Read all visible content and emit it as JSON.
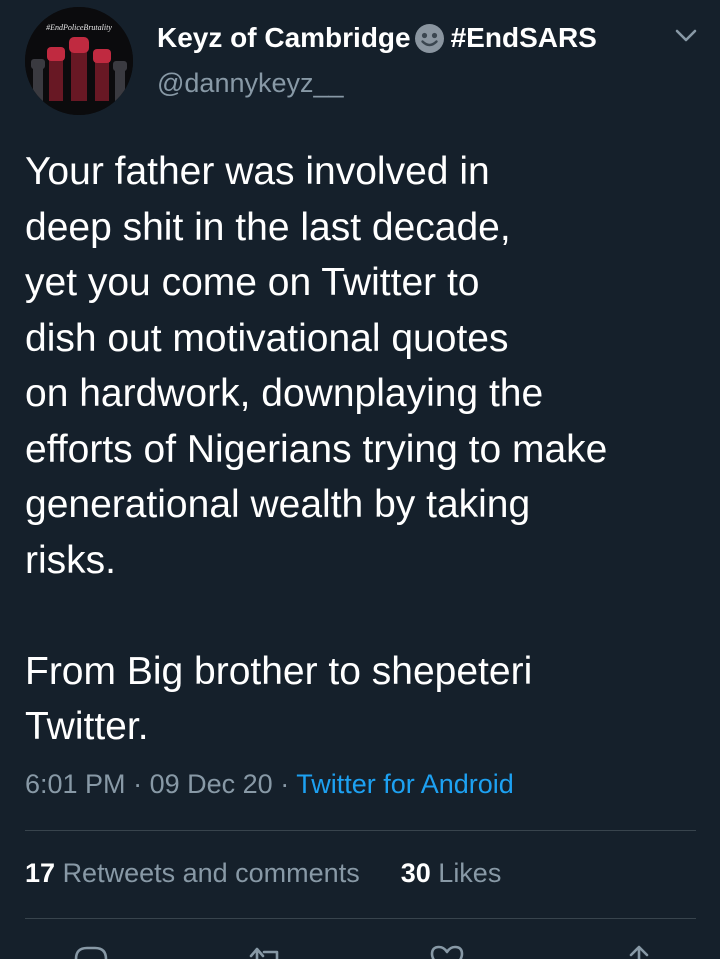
{
  "tweet": {
    "avatar_badge_text": "#EndPoliceBrutality",
    "author": {
      "display_name": "Keyz of Cambridge",
      "name_emoji": "smiling-face-emoji",
      "hashtag": "#EndSARS",
      "handle": "@dannykeyz__"
    },
    "paragraphs": [
      "Your father was involved in\ndeep shit in the last decade,\nyet you come on Twitter to\ndish out motivational quotes\non hardwork, downplaying the\nefforts of Nigerians trying to make\ngenerational wealth by taking\nrisks.",
      "From Big brother to shepeteri\nTwitter."
    ],
    "time": "6:01 PM",
    "separator": "·",
    "date": "09 Dec 20",
    "source": "Twitter for Android",
    "retweets_count": "17",
    "retweets_label": "Retweets and comments",
    "likes_count": "30",
    "likes_label": "Likes"
  },
  "colors": {
    "background": "#15202b",
    "text": "#ffffff",
    "secondary_text": "#8899a6",
    "accent": "#1da1f2",
    "divider": "#38444d"
  },
  "icons": {
    "caret": "chevron-down-icon",
    "reply": "reply-icon",
    "retweet": "retweet-icon",
    "like": "heart-icon",
    "share": "share-icon"
  }
}
